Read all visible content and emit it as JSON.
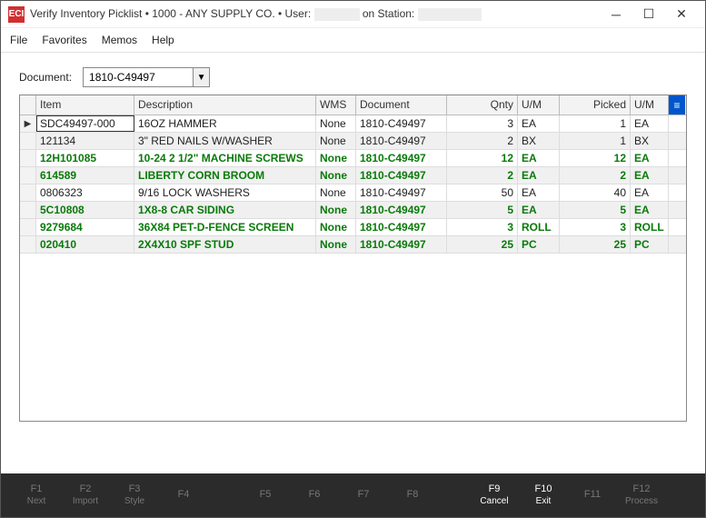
{
  "title_prefix": "Verify Inventory Picklist  •  1000 - ANY SUPPLY CO.  •  User:",
  "title_station": " on Station:",
  "logo": "ECI",
  "menu": {
    "file": "File",
    "favorites": "Favorites",
    "memos": "Memos",
    "help": "Help"
  },
  "toolbar": {
    "document_label": "Document:",
    "document_value": "1810-C49497"
  },
  "grid": {
    "headers": {
      "item": "Item",
      "desc": "Description",
      "wms": "WMS",
      "doc": "Document",
      "qnty": "Qnty",
      "um1": "U/M",
      "picked": "Picked",
      "um2": "U/M"
    },
    "rows": [
      {
        "item": "SDC49497-000",
        "desc": "16OZ HAMMER",
        "wms": "None",
        "doc": "1810-C49497",
        "qnty": "3",
        "um1": "EA",
        "picked": "1",
        "um2": "EA",
        "green": false,
        "selected": true,
        "alt": false
      },
      {
        "item": "121134",
        "desc": "3\" RED NAILS W/WASHER",
        "wms": "None",
        "doc": "1810-C49497",
        "qnty": "2",
        "um1": "BX",
        "picked": "1",
        "um2": "BX",
        "green": false,
        "alt": true
      },
      {
        "item": "12H101085",
        "desc": "10-24 2 1/2\" MACHINE SCREWS",
        "wms": "None",
        "doc": "1810-C49497",
        "qnty": "12",
        "um1": "EA",
        "picked": "12",
        "um2": "EA",
        "green": true,
        "alt": false
      },
      {
        "item": "614589",
        "desc": "LIBERTY CORN BROOM",
        "wms": "None",
        "doc": "1810-C49497",
        "qnty": "2",
        "um1": "EA",
        "picked": "2",
        "um2": "EA",
        "green": true,
        "alt": true
      },
      {
        "item": "0806323",
        "desc": "9/16         LOCK WASHERS",
        "wms": "None",
        "doc": "1810-C49497",
        "qnty": "50",
        "um1": "EA",
        "picked": "40",
        "um2": "EA",
        "green": false,
        "alt": false
      },
      {
        "item": "5C10808",
        "desc": "1X8-8 CAR SIDING",
        "wms": "None",
        "doc": "1810-C49497",
        "qnty": "5",
        "um1": "EA",
        "picked": "5",
        "um2": "EA",
        "green": true,
        "alt": true
      },
      {
        "item": "9279684",
        "desc": "36X84 PET-D-FENCE SCREEN",
        "wms": "None",
        "doc": "1810-C49497",
        "qnty": "3",
        "um1": "ROLL",
        "picked": "3",
        "um2": "ROLL",
        "green": true,
        "alt": false
      },
      {
        "item": "020410",
        "desc": "2X4X10 SPF STUD",
        "wms": "None",
        "doc": "1810-C49497",
        "qnty": "25",
        "um1": "PC",
        "picked": "25",
        "um2": "PC",
        "green": true,
        "alt": true
      }
    ]
  },
  "fkeys": [
    {
      "k": "F1",
      "lbl": "Next",
      "active": false
    },
    {
      "k": "F2",
      "lbl": "Import",
      "active": false
    },
    {
      "k": "F3",
      "lbl": "Style",
      "active": false
    },
    {
      "k": "F4",
      "lbl": "",
      "active": false
    },
    {
      "k": "F5",
      "lbl": "",
      "active": false
    },
    {
      "k": "F6",
      "lbl": "",
      "active": false
    },
    {
      "k": "F7",
      "lbl": "",
      "active": false
    },
    {
      "k": "F8",
      "lbl": "",
      "active": false
    },
    {
      "k": "F9",
      "lbl": "Cancel",
      "active": true
    },
    {
      "k": "F10",
      "lbl": "Exit",
      "active": true
    },
    {
      "k": "F11",
      "lbl": "",
      "active": false
    },
    {
      "k": "F12",
      "lbl": "Process",
      "active": false
    }
  ]
}
